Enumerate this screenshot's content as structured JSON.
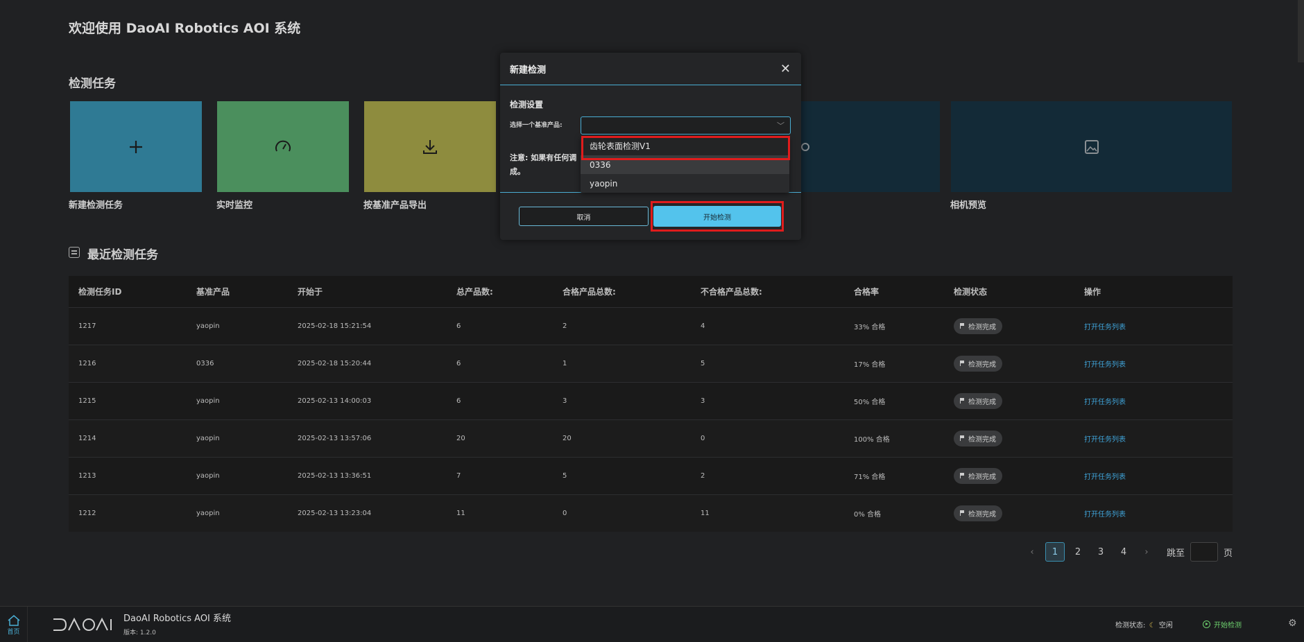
{
  "page": {
    "welcome": "欢迎使用 DaoAI Robotics AOI 系统",
    "section_tasks": "检测任务",
    "section_recent": "最近检测任务"
  },
  "cards": [
    {
      "label": "新建检测任务",
      "icon": "plus-icon",
      "color": "#2f7a94"
    },
    {
      "label": "实时监控",
      "icon": "speedometer-icon",
      "color": "#4b8f5d"
    },
    {
      "label": "按基准产品导出",
      "icon": "download-icon",
      "color": "#8e8c3e"
    },
    {
      "label": "",
      "icon": "gear-icon",
      "color": "#132a37"
    },
    {
      "label": "相机预览",
      "icon": "image-icon",
      "color": "#132a37"
    }
  ],
  "table": {
    "headers": [
      "检测任务ID",
      "基准产品",
      "开始于",
      "总产品数:",
      "合格产品总数:",
      "不合格产品总数:",
      "合格率",
      "检测状态",
      "操作"
    ],
    "rows": [
      {
        "id": "1217",
        "product": "yaopin",
        "start": "2025-02-18 15:21:54",
        "total": "6",
        "pass": "2",
        "fail": "4",
        "rate": "33% 合格",
        "status": "检测完成",
        "action": "打开任务列表"
      },
      {
        "id": "1216",
        "product": "0336",
        "start": "2025-02-18 15:20:44",
        "total": "6",
        "pass": "1",
        "fail": "5",
        "rate": "17% 合格",
        "status": "检测完成",
        "action": "打开任务列表"
      },
      {
        "id": "1215",
        "product": "yaopin",
        "start": "2025-02-13 14:00:03",
        "total": "6",
        "pass": "3",
        "fail": "3",
        "rate": "50% 合格",
        "status": "检测完成",
        "action": "打开任务列表"
      },
      {
        "id": "1214",
        "product": "yaopin",
        "start": "2025-02-13 13:57:06",
        "total": "20",
        "pass": "20",
        "fail": "0",
        "rate": "100% 合格",
        "status": "检测完成",
        "action": "打开任务列表"
      },
      {
        "id": "1213",
        "product": "yaopin",
        "start": "2025-02-13 13:36:51",
        "total": "7",
        "pass": "5",
        "fail": "2",
        "rate": "71% 合格",
        "status": "检测完成",
        "action": "打开任务列表"
      },
      {
        "id": "1212",
        "product": "yaopin",
        "start": "2025-02-13 13:23:04",
        "total": "11",
        "pass": "0",
        "fail": "11",
        "rate": "0% 合格",
        "status": "检测完成",
        "action": "打开任务列表"
      }
    ]
  },
  "pager": {
    "pages": [
      "1",
      "2",
      "3",
      "4"
    ],
    "active": "1",
    "prev": "‹",
    "next": "›",
    "jump_label": "跳至",
    "page_suffix": "页"
  },
  "modal": {
    "title": "新建检测",
    "close": "✕",
    "subtitle": "检测设置",
    "field_label": "选择一个基准产品:",
    "note": "注意: 如果有任何调整完成,",
    "note_line1": "注意: 如果有任何调",
    "note_line2": "成。",
    "cancel": "取消",
    "start": "开始检测",
    "options": [
      "齿轮表面检测V1",
      "0336",
      "yaopin"
    ]
  },
  "footer": {
    "home_label": "首页",
    "app_name": "DaoAI Robotics AOI 系统",
    "version": "版本: 1.2.0",
    "status_label": "检测状态:",
    "status_value": "空闲",
    "start_label": "开始检测"
  },
  "colors": {
    "accent": "#4aaed4",
    "primary_button": "#53c3ec",
    "highlight": "#e01c1c",
    "link": "#3fa3d8"
  }
}
